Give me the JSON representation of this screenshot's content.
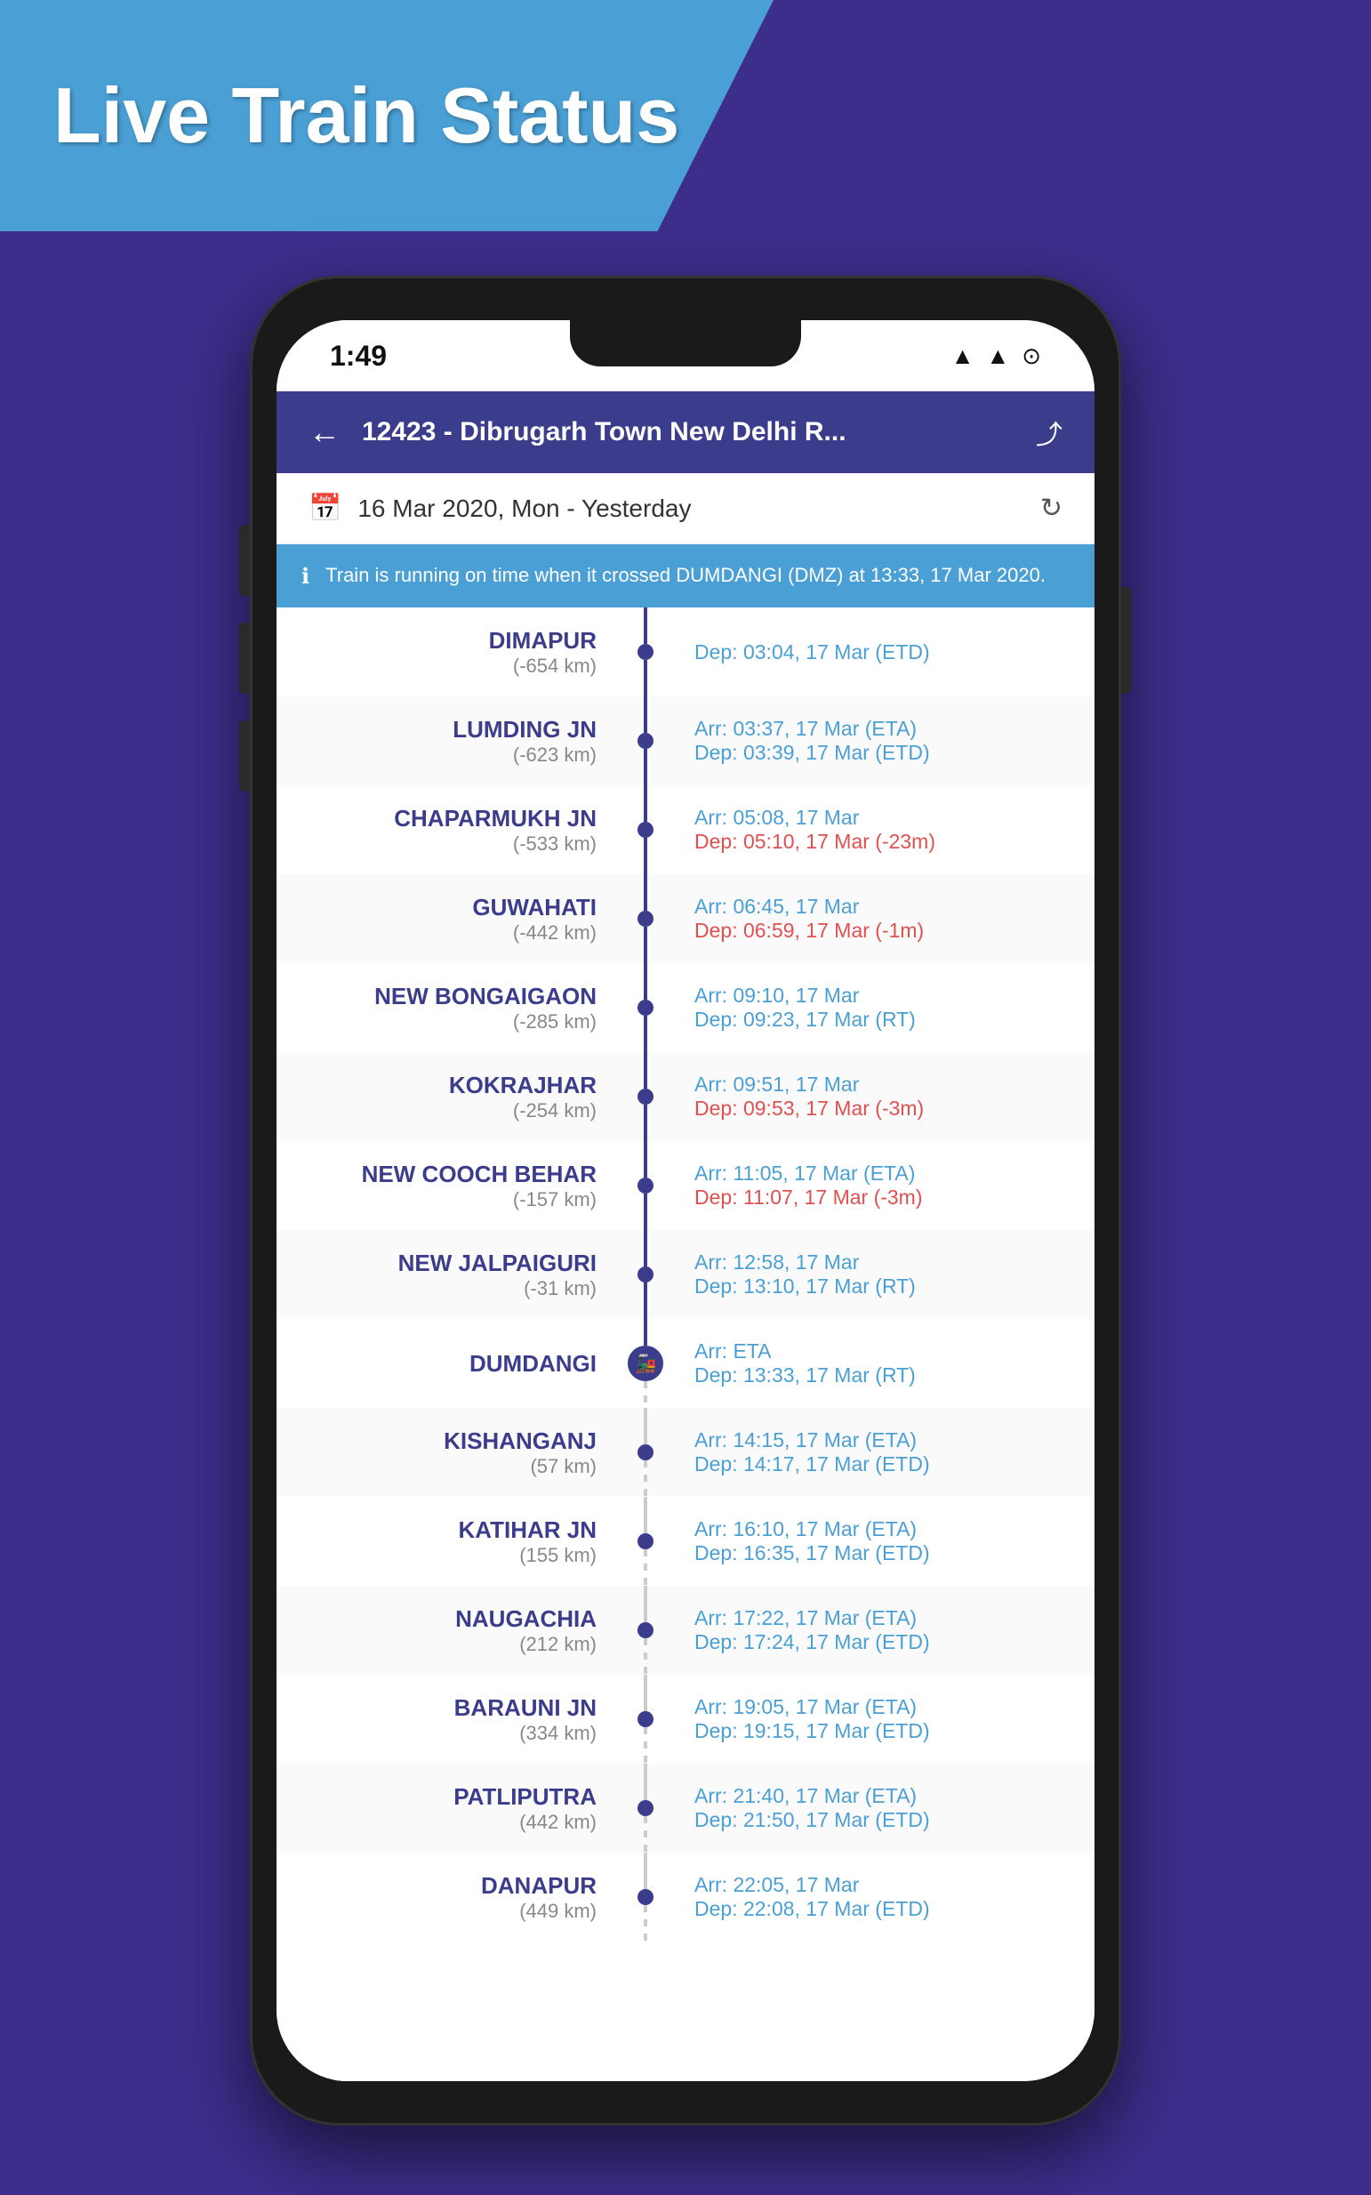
{
  "banner": {
    "title": "Live Train Status"
  },
  "statusBar": {
    "time": "1:49",
    "icons": [
      "signal",
      "wifi",
      "battery"
    ]
  },
  "header": {
    "back": "←",
    "title": "12423 - Dibrugarh Town New Delhi R...",
    "share": "⤴"
  },
  "dateBar": {
    "date": "16 Mar 2020, Mon - Yesterday"
  },
  "infoBanner": {
    "text": "Train is running on time when it crossed DUMDANGI (DMZ) at 13:33, 17 Mar 2020."
  },
  "stations": [
    {
      "name": "DIMAPUR",
      "dist": "(-654 km)",
      "arr": "",
      "dep": "Dep: 03:04, 17 Mar (ETD)",
      "depClass": "dep-blue",
      "type": "normal"
    },
    {
      "name": "LUMDING JN",
      "dist": "(-623 km)",
      "arr": "Arr: 03:37, 17 Mar (ETA)",
      "dep": "Dep: 03:39, 17 Mar (ETD)",
      "depClass": "dep-blue",
      "type": "normal"
    },
    {
      "name": "CHAPARMUKH JN",
      "dist": "(-533 km)",
      "arr": "Arr: 05:08, 17 Mar",
      "dep": "Dep: 05:10, 17 Mar (-23m)",
      "depClass": "dep-red",
      "type": "normal"
    },
    {
      "name": "GUWAHATI",
      "dist": "(-442 km)",
      "arr": "Arr: 06:45, 17 Mar",
      "dep": "Dep: 06:59, 17 Mar (-1m)",
      "depClass": "dep-red",
      "type": "normal"
    },
    {
      "name": "NEW BONGAIGAON",
      "dist": "(-285 km)",
      "arr": "Arr: 09:10, 17 Mar",
      "dep": "Dep: 09:23, 17 Mar (RT)",
      "depClass": "dep-blue",
      "type": "normal"
    },
    {
      "name": "KOKRAJHAR",
      "dist": "(-254 km)",
      "arr": "Arr: 09:51, 17 Mar",
      "dep": "Dep: 09:53, 17 Mar (-3m)",
      "depClass": "dep-red",
      "type": "normal"
    },
    {
      "name": "NEW COOCH BEHAR",
      "dist": "(-157 km)",
      "arr": "Arr: 11:05, 17 Mar (ETA)",
      "dep": "Dep: 11:07, 17 Mar (-3m)",
      "depClass": "dep-red",
      "type": "normal"
    },
    {
      "name": "NEW JALPAIGURI",
      "dist": "(-31 km)",
      "arr": "Arr: 12:58, 17 Mar",
      "dep": "Dep: 13:10, 17 Mar (RT)",
      "depClass": "dep-blue",
      "type": "normal"
    },
    {
      "name": "DUMDANGI",
      "dist": "",
      "arr": "Arr: ETA",
      "dep": "Dep: 13:33, 17 Mar (RT)",
      "depClass": "dep-blue",
      "type": "active"
    },
    {
      "name": "KISHANGANJ",
      "dist": "(57 km)",
      "arr": "Arr: 14:15, 17 Mar (ETA)",
      "dep": "Dep: 14:17, 17 Mar (ETD)",
      "depClass": "dep-blue",
      "type": "future"
    },
    {
      "name": "KATIHAR JN",
      "dist": "(155 km)",
      "arr": "Arr: 16:10, 17 Mar (ETA)",
      "dep": "Dep: 16:35, 17 Mar (ETD)",
      "depClass": "dep-blue",
      "type": "future"
    },
    {
      "name": "NAUGACHIA",
      "dist": "(212 km)",
      "arr": "Arr: 17:22, 17 Mar (ETA)",
      "dep": "Dep: 17:24, 17 Mar (ETD)",
      "depClass": "dep-blue",
      "type": "future"
    },
    {
      "name": "BARAUNI JN",
      "dist": "(334 km)",
      "arr": "Arr: 19:05, 17 Mar (ETA)",
      "dep": "Dep: 19:15, 17 Mar (ETD)",
      "depClass": "dep-blue",
      "type": "future"
    },
    {
      "name": "PATLIPUTRA",
      "dist": "(442 km)",
      "arr": "Arr: 21:40, 17 Mar (ETA)",
      "dep": "Dep: 21:50, 17 Mar (ETD)",
      "depClass": "dep-blue",
      "type": "future"
    },
    {
      "name": "DANAPUR",
      "dist": "(449 km)",
      "arr": "Arr: 22:05, 17 Mar",
      "dep": "Dep: 22:08, 17 Mar (ETD)",
      "depClass": "dep-blue",
      "type": "future"
    }
  ]
}
